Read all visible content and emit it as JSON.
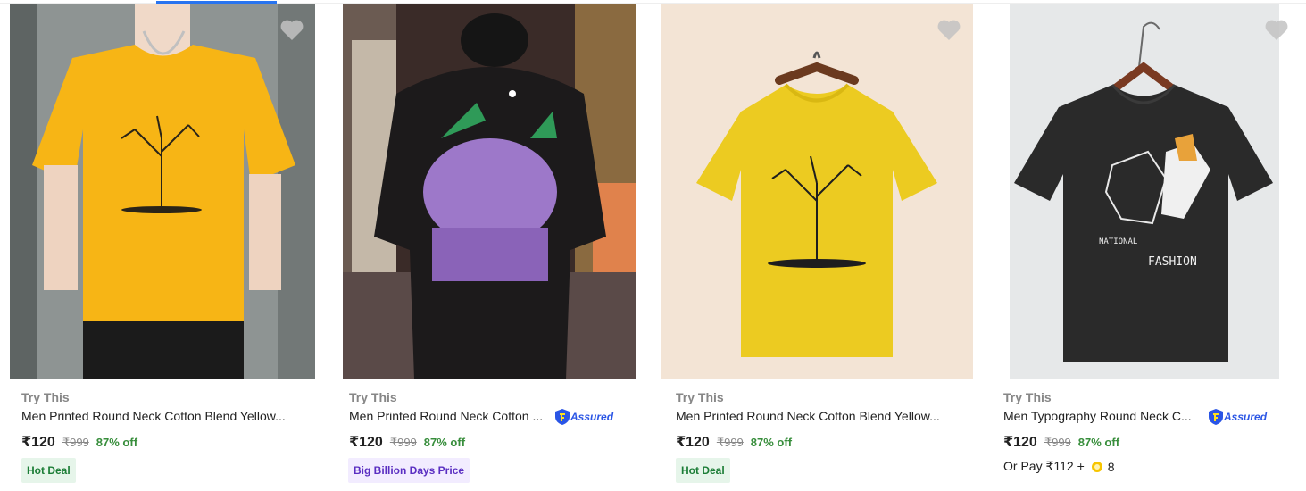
{
  "products": [
    {
      "brand": "Try This",
      "title": "Men Printed Round Neck Cotton Blend Yellow...",
      "assured": "",
      "price": "₹120",
      "mrp": "₹999",
      "discount": "87% off",
      "badge": "Hot Deal",
      "or_pay": "",
      "coins": "",
      "image": {
        "subject": "man-wearing-yellow-tree-print-tshirt",
        "shirt_color": "#f7b515"
      }
    },
    {
      "brand": "Try This",
      "title": "Men Printed Round Neck Cotton ...",
      "assured": "Assured",
      "price": "₹120",
      "mrp": "₹999",
      "discount": "87% off",
      "badge": "Big Billion Days Price",
      "or_pay": "",
      "coins": "",
      "image": {
        "subject": "man-back-black-tshirt-purple-sneaker-print",
        "shirt_color": "#1c1a1b"
      }
    },
    {
      "brand": "Try This",
      "title": "Men Printed Round Neck Cotton Blend Yellow...",
      "assured": "",
      "price": "₹120",
      "mrp": "₹999",
      "discount": "87% off",
      "badge": "Hot Deal",
      "or_pay": "",
      "coins": "",
      "image": {
        "subject": "yellow-tree-print-tshirt-on-hanger",
        "shirt_color": "#eccb21"
      }
    },
    {
      "brand": "Try This",
      "title": "Men Typography Round Neck C...",
      "assured": "Assured",
      "price": "₹120",
      "mrp": "₹999",
      "discount": "87% off",
      "badge": "",
      "or_pay": "Or Pay ₹112 +",
      "coins": "8",
      "image": {
        "subject": "black-typography-tshirt-on-hanger",
        "shirt_color": "#2a2a2a"
      }
    }
  ],
  "colors": {
    "accent": "#2874f0",
    "discount": "#388e3c",
    "brand_text": "#878787",
    "assured": "#2a55e5",
    "wishlist": "#c2c2c2"
  }
}
